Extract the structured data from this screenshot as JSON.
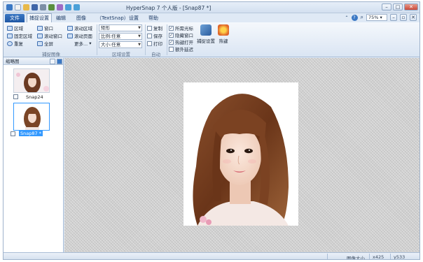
{
  "window": {
    "title": "HyperSnap 7 个人版 - [Snap87 *]"
  },
  "tabs": [
    {
      "label": "文件"
    },
    {
      "label": "捕捉设置"
    },
    {
      "label": "编辑"
    },
    {
      "label": "图像"
    },
    {
      "label": "（TextSnap）"
    },
    {
      "label": "设置"
    },
    {
      "label": "帮助"
    }
  ],
  "zoom": {
    "value": "75%"
  },
  "ribbon": {
    "capture": {
      "region": "区域",
      "fixed_region": "固定区域",
      "repeat": "重复",
      "window": "窗口",
      "scroll_window": "滚动窗口",
      "fullscreen": "全屏",
      "scroll_region": "滚动区域",
      "scroll_page": "滚动页面",
      "more": "更多...",
      "group_label": "捕捉图像"
    },
    "region_settings": {
      "shape": "矩形",
      "ratio": "比例:任意",
      "size": "大小:任意",
      "group_label": "区域设置"
    },
    "auto": {
      "copy": "复制",
      "save": "保存",
      "print": "打印",
      "group_label": "自动"
    },
    "options": {
      "cursor": "所需光标",
      "hide_window": "隐藏窗口",
      "hotkey_open": "热键打开",
      "extra_delay": "额外延迟",
      "cursor_checked": true,
      "hide_window_checked": true,
      "hotkey_open_checked": true,
      "extra_delay_checked": false
    },
    "capture_settings_label": "捕捉设置",
    "hotkey_label": "热键"
  },
  "left_panel": {
    "title": "缩略图",
    "thumbnails": [
      {
        "label": "Snap24"
      },
      {
        "label": "Snap87 *"
      }
    ]
  },
  "status": {
    "image_size_label": "图像大小",
    "x": "x425",
    "y": "y533"
  },
  "colors": {
    "accent": "#1f57a4",
    "ribbon": "#dae5f3",
    "selection": "#3399ff"
  }
}
